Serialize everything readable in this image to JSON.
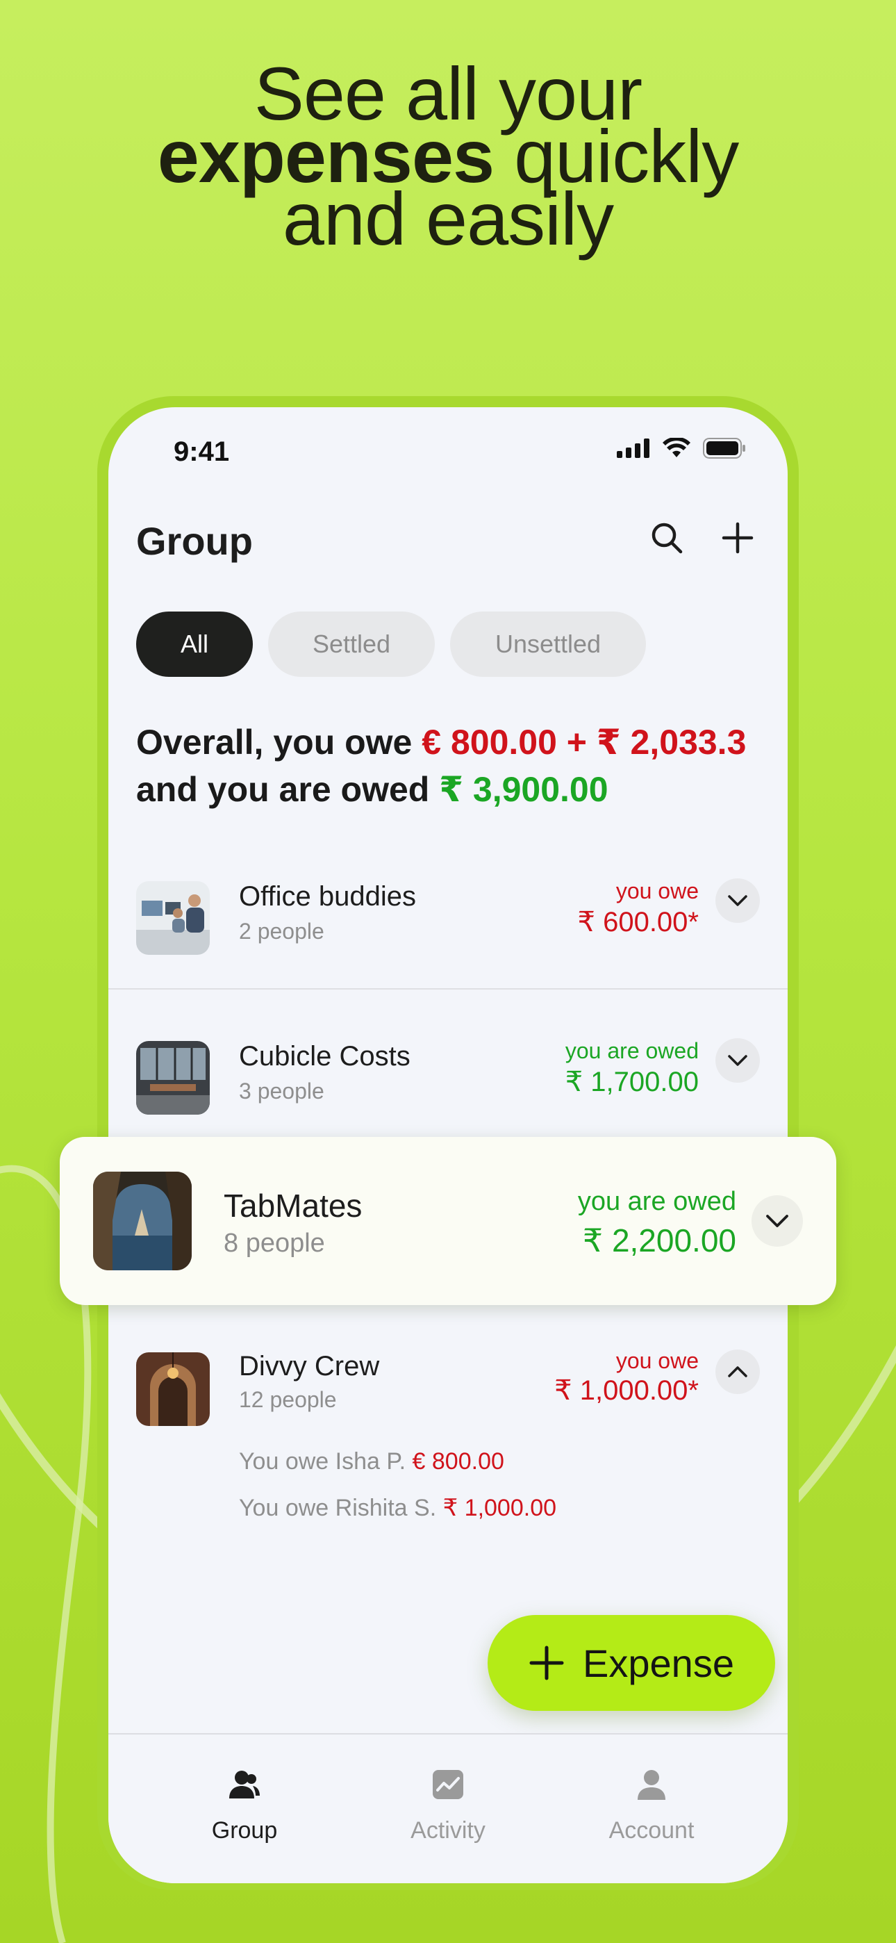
{
  "headline": {
    "line1": "See all your",
    "line2_bold": "expenses",
    "line2_rest": " quickly",
    "line3": "and easily"
  },
  "status_bar": {
    "time": "9:41"
  },
  "header": {
    "title": "Group"
  },
  "tabs": [
    {
      "label": "All",
      "active": true
    },
    {
      "label": "Settled",
      "active": false
    },
    {
      "label": "Unsettled",
      "active": false
    }
  ],
  "summary": {
    "prefix": "Overall, you owe ",
    "owe_amount": "€ 800.00 + ₹ 2,033.3",
    "middle": "and you are owed ",
    "owed_amount": "₹ 3,900.00"
  },
  "groups": [
    {
      "name": "Office buddies",
      "people": "2 people",
      "status": "you owe",
      "amount": "₹ 600.00*",
      "tone": "owe"
    },
    {
      "name": "Cubicle Costs",
      "people": "3 people",
      "status": "you are owed",
      "amount": "₹ 1,700.00",
      "tone": "owed"
    },
    {
      "name": "TabMates",
      "people": "8 people",
      "status": "you are owed",
      "amount": "₹ 2,200.00",
      "tone": "owed"
    },
    {
      "name": "Divvy Crew",
      "people": "12 people",
      "status": "you owe",
      "amount": "₹ 1,000.00*",
      "tone": "owe",
      "details": [
        {
          "text": "You owe Isha P. ",
          "amount": "€ 800.00"
        },
        {
          "text": "You owe Rishita S. ",
          "amount": "₹ 1,000.00"
        }
      ]
    }
  ],
  "fab": {
    "label": "Expense"
  },
  "bottom_nav": [
    {
      "label": "Group",
      "icon": "group-icon",
      "active": true
    },
    {
      "label": "Activity",
      "icon": "activity-icon",
      "active": false
    },
    {
      "label": "Account",
      "icon": "account-icon",
      "active": false
    }
  ],
  "colors": {
    "owe": "#d0131b",
    "owed": "#1ba624",
    "accent": "#b4eb17",
    "background": "#b6e640"
  }
}
